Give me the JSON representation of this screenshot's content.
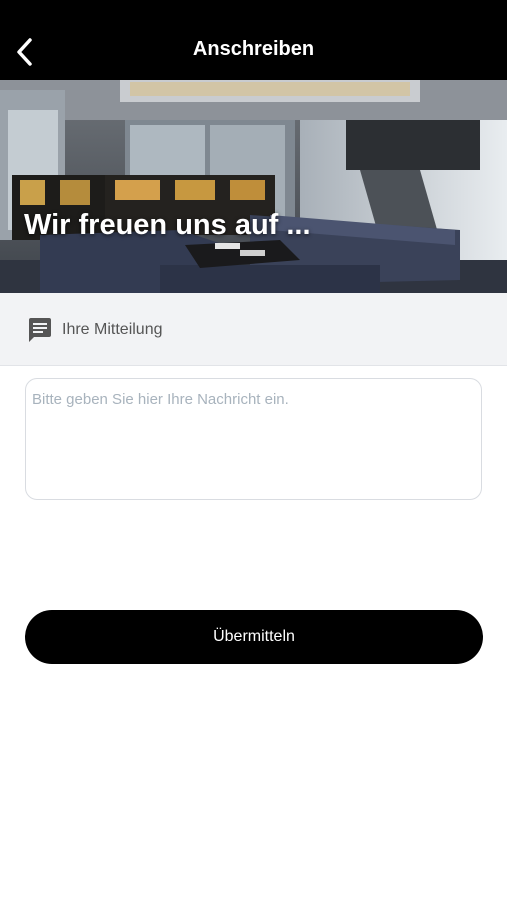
{
  "header": {
    "title": "Anschreiben",
    "back_icon": "chevron-left-icon"
  },
  "hero": {
    "headline": "Wir freuen uns auf ..."
  },
  "section": {
    "label": "Ihre Mitteilung",
    "icon": "message-icon"
  },
  "message": {
    "value": "",
    "placeholder": "Bitte geben Sie hier Ihre Nachricht ein."
  },
  "submit": {
    "label": "Übermitteln"
  },
  "colors": {
    "header_bg": "#000000",
    "section_bg": "#f2f3f5",
    "button_bg": "#000000"
  }
}
